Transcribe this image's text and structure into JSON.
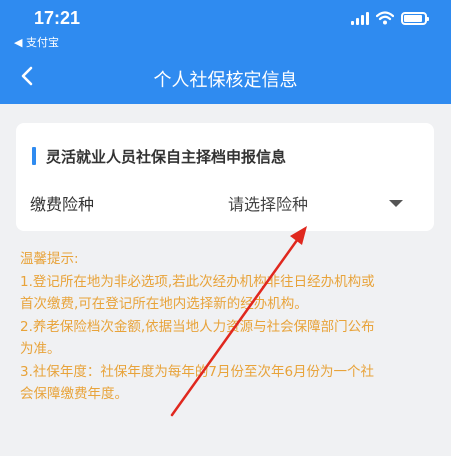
{
  "status_bar": {
    "time": "17:21",
    "back_app": "◀ 支付宝",
    "signal_icon": "signal-bars-icon",
    "wifi_icon": "wifi-icon",
    "battery_icon": "battery-icon",
    "battery_level": 0.9
  },
  "nav": {
    "title": "个人社保核定信息",
    "back_icon": "chevron-left-icon"
  },
  "card": {
    "title": "灵活就业人员社保自主择档申报信息",
    "field_label": "缴费险种",
    "field_value": "请选择险种",
    "dropdown_icon": "caret-down-icon"
  },
  "notice": {
    "heading": "温馨提示:",
    "lines": [
      "1.登记所在地为非必选项,若此次经办机构非往日经办机构或",
      "首次缴费,可在登记所在地内选择新的经办机构。",
      "2.养老保险档次金额,依据当地人力资源与社会保障部门公布",
      "为准。",
      "3.社保年度：社保年度为每年的7月份至次年6月份为一个社",
      "会保障缴费年度。"
    ]
  },
  "colors": {
    "primary": "#2f8bf0",
    "notice_text": "#e8a33a",
    "annotation_arrow": "#e0281e",
    "background": "#f0f1f3"
  }
}
